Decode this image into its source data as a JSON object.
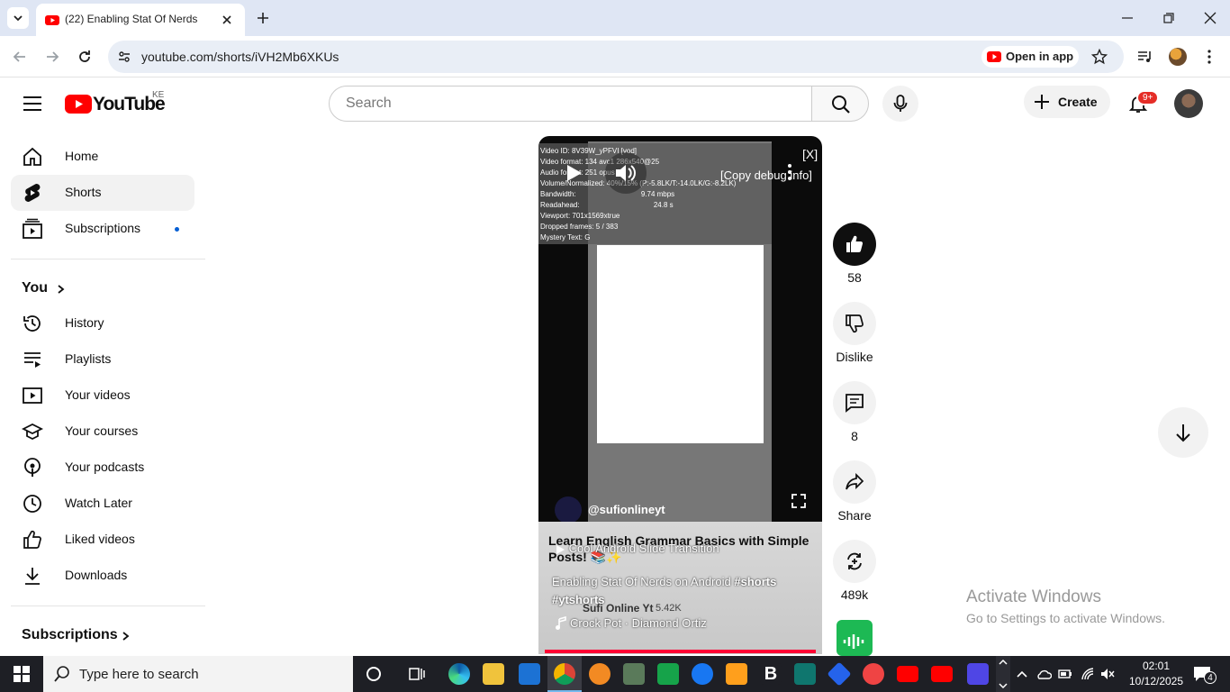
{
  "browser": {
    "tab_title": "(22) Enabling Stat Of Nerds",
    "url": "youtube.com/shorts/iVH2Mb6XKUs",
    "open_in_app": "Open in app"
  },
  "header": {
    "logo_text": "YouTube",
    "country_code": "KE",
    "search_placeholder": "Search",
    "create_label": "Create",
    "notification_badge": "9+"
  },
  "sidebar": {
    "main": [
      {
        "label": "Home",
        "icon": "home-icon"
      },
      {
        "label": "Shorts",
        "icon": "shorts-icon"
      },
      {
        "label": "Subscriptions",
        "icon": "subscriptions-icon"
      }
    ],
    "you_label": "You",
    "you_items": [
      {
        "label": "History",
        "icon": "history-icon"
      },
      {
        "label": "Playlists",
        "icon": "playlists-icon"
      },
      {
        "label": "Your videos",
        "icon": "your-videos-icon"
      },
      {
        "label": "Your courses",
        "icon": "courses-icon"
      },
      {
        "label": "Your podcasts",
        "icon": "podcasts-icon"
      },
      {
        "label": "Watch Later",
        "icon": "clock-icon"
      },
      {
        "label": "Liked videos",
        "icon": "thumbs-up-icon"
      },
      {
        "label": "Downloads",
        "icon": "download-icon"
      }
    ],
    "subscriptions_label": "Subscriptions"
  },
  "video": {
    "debug_lines": [
      "Video ID: 8V39W_yPFVI [vod]",
      "Video format: 134 avc1 286x540@25",
      "Audio format: 251 opus",
      "Volume/Normalized: 40%/15% (P:-5.8LK/T:-14.0LK/G:-8.2LK)",
      "Bandwidth:",
      "Readahead:",
      "Viewport: 701x1569xtrue",
      "Dropped frames: 5 / 383",
      "Mystery Text: G"
    ],
    "bandwidth": "9.74 mbps",
    "readahead": "24.8 s",
    "copy_debug": "[Copy debug info]",
    "close_debug": "[X]",
    "channel_handle": "@sufionlineyt",
    "ghost_title": "Cool Android Slide Transition",
    "title": "Learn English Grammar Basics with Simple Posts! 📚✨",
    "description": "Enabling Stat Of Nerds on Android",
    "hashtags": [
      "#shorts",
      "#ytshorts"
    ],
    "ghost_channel": "Sufi Online Yt",
    "ghost_subs": "5.42K",
    "sound": "Crock Pot · Diamond Ortiz",
    "accent": "#ff0033"
  },
  "actions": {
    "likes": "58",
    "dislike_label": "Dislike",
    "comments": "8",
    "share_label": "Share",
    "remix_count": "489k"
  },
  "watermark": {
    "line1": "Activate Windows",
    "line2": "Go to Settings to activate Windows."
  },
  "taskbar": {
    "search_placeholder": "Type here to search",
    "time": "02:01",
    "date": "10/12/2025",
    "notification_count": "4"
  }
}
